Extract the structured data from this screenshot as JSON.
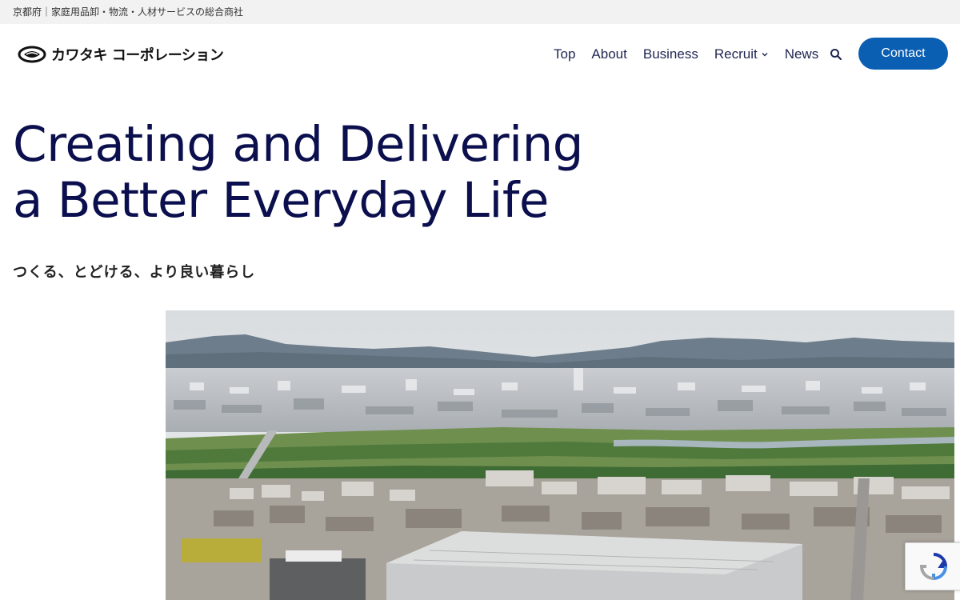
{
  "topbar": {
    "tagline": "京都府｜家庭用品卸・物流・人材サービスの総合商社"
  },
  "header": {
    "logo_text": "カワタキ コーポレーション",
    "nav": [
      {
        "label": "Top"
      },
      {
        "label": "About"
      },
      {
        "label": "Business"
      },
      {
        "label": "Recruit",
        "has_dropdown": true
      },
      {
        "label": "News"
      }
    ],
    "search_icon": "search-icon",
    "contact_label": "Contact",
    "accent_color": "#0a5fb3"
  },
  "hero": {
    "title_line1": "Creating and Delivering",
    "title_line2": "a Better Everyday Life",
    "subtitle": "つくる、とどける、より良い暮らし",
    "title_color": "#0b0f4d"
  },
  "photo": {
    "subject": "aerial-city-landscape"
  },
  "recaptcha": {
    "icon": "recaptcha-icon"
  }
}
